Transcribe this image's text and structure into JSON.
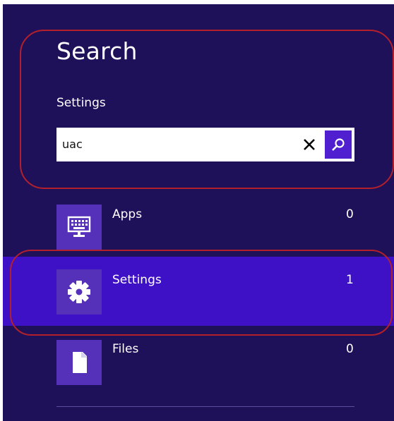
{
  "search_pane": {
    "title": "Search",
    "scope": "Settings",
    "query": "uac",
    "clear_icon": "close-icon",
    "search_icon": "magnifier-icon"
  },
  "results": [
    {
      "label": "Apps",
      "count": "0",
      "icon": "apps-keyboard-icon"
    },
    {
      "label": "Settings",
      "count": "1",
      "icon": "gear-icon",
      "selected": true
    },
    {
      "label": "Files",
      "count": "0",
      "icon": "document-icon"
    }
  ],
  "colors": {
    "pane_background": "#1e1159",
    "selected_row": "#3e10c6",
    "tile": "#5531b9",
    "search_button": "#4f1fd0",
    "annotation_ring": "#b3202c"
  }
}
